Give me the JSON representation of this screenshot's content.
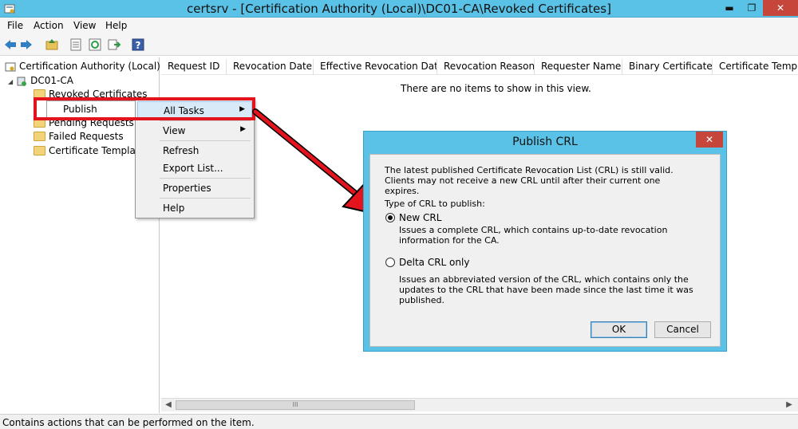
{
  "window": {
    "title": "certsrv - [Certification Authority (Local)\\DC01-CA\\Revoked Certificates]",
    "min_glyph": "▬",
    "max_glyph": "❐",
    "close_glyph": "✕"
  },
  "menu": [
    "File",
    "Action",
    "View",
    "Help"
  ],
  "toolbar_icons": [
    "back-arrow-icon",
    "forward-arrow-icon",
    "up-folder-icon",
    "properties-icon",
    "refresh-icon",
    "export-icon",
    "help-icon"
  ],
  "tree": {
    "root": "Certification Authority (Local)",
    "ca": "DC01-CA",
    "folders": [
      "Revoked Certificates",
      "Pending Requests",
      "Failed Requests",
      "Certificate Templates"
    ]
  },
  "columns": [
    "Request ID",
    "Revocation Date",
    "Effective Revocation Date",
    "Revocation Reason",
    "Requester Name",
    "Binary Certificate",
    "Certificate Templat"
  ],
  "empty_message": "There are no items to show in this view.",
  "publish_menu": {
    "label": "Publish"
  },
  "context_menu": {
    "all_tasks": "All Tasks",
    "view": "View",
    "refresh": "Refresh",
    "export": "Export List...",
    "properties": "Properties",
    "help": "Help"
  },
  "dialog": {
    "title": "Publish CRL",
    "close_glyph": "✕",
    "intro": "The latest published Certificate Revocation List (CRL) is still valid. Clients may not receive a new CRL until after their current one expires.",
    "type_label": "Type of CRL to publish:",
    "new_crl": "New CRL",
    "new_crl_desc": "Issues a complete CRL, which contains up-to-date revocation information for the CA.",
    "delta_crl": "Delta CRL only",
    "delta_crl_desc": "Issues an abbreviated version of the CRL, which contains only the updates to the CRL that have been made since the last time it was published.",
    "ok": "OK",
    "cancel": "Cancel",
    "selected": "New CRL"
  },
  "scrollbar": {
    "left": "◀",
    "right": "▶",
    "thumb": "III"
  },
  "status": "Contains actions that can be performed on the item.",
  "colors": {
    "title_bar": "#5bc2e7",
    "close_red": "#c7463b",
    "highlight_red": "#e3141d"
  }
}
